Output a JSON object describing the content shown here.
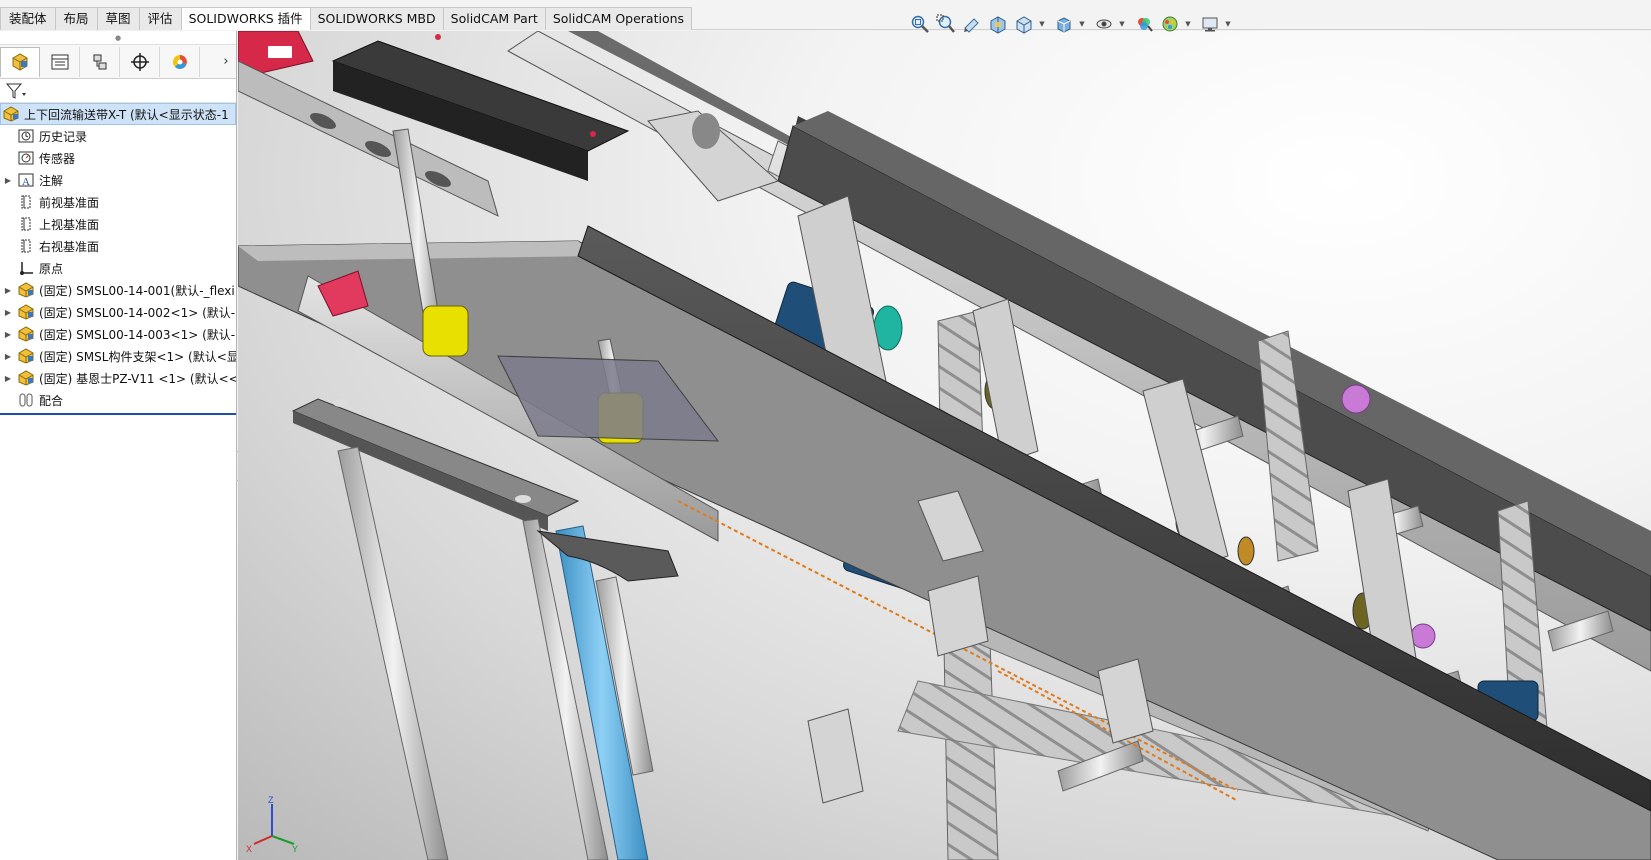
{
  "ribbon": {
    "tabs": [
      {
        "label": "装配体",
        "active": false
      },
      {
        "label": "布局",
        "active": false
      },
      {
        "label": "草图",
        "active": false
      },
      {
        "label": "评估",
        "active": false
      },
      {
        "label": "SOLIDWORKS 插件",
        "active": true
      },
      {
        "label": "SOLIDWORKS MBD",
        "active": false
      },
      {
        "label": "SolidCAM Part",
        "active": false
      },
      {
        "label": "SolidCAM Operations",
        "active": false
      }
    ]
  },
  "view_toolbar": {
    "icons": [
      "zoom-to-fit-icon",
      "zoom-to-area-icon",
      "previous-view-icon",
      "section-view-icon",
      "view-orientation-icon",
      "display-style-icon",
      "hide-show-items-icon",
      "edit-appearance-icon",
      "apply-scene-icon",
      "view-settings-icon"
    ]
  },
  "feature_tree": {
    "panel_tabs": [
      "feature-manager-icon",
      "property-manager-icon",
      "configuration-manager-icon",
      "dimxpert-manager-icon",
      "display-manager-icon"
    ],
    "root": "上下回流输送带X-T  (默认<显示状态-1",
    "items": [
      {
        "label": "历史记录",
        "icon": "history-icon",
        "expandable": false
      },
      {
        "label": "传感器",
        "icon": "sensor-icon",
        "expandable": false
      },
      {
        "label": "注解",
        "icon": "annotation-icon",
        "expandable": true
      },
      {
        "label": "前视基准面",
        "icon": "plane-icon",
        "expandable": false
      },
      {
        "label": "上视基准面",
        "icon": "plane-icon",
        "expandable": false
      },
      {
        "label": "右视基准面",
        "icon": "plane-icon",
        "expandable": false
      },
      {
        "label": "原点",
        "icon": "origin-icon",
        "expandable": false
      },
      {
        "label": "(固定) SMSL00-14-001(默认-_flexi",
        "icon": "assembly-icon",
        "expandable": true
      },
      {
        "label": "(固定) SMSL00-14-002<1> (默认-",
        "icon": "assembly-icon",
        "expandable": true
      },
      {
        "label": "(固定) SMSL00-14-003<1> (默认-",
        "icon": "assembly-icon",
        "expandable": true
      },
      {
        "label": "(固定) SMSL构件支架<1> (默认<显",
        "icon": "assembly-icon",
        "expandable": true
      },
      {
        "label": "(固定) 基恩士PZ-V11 <1> (默认<<",
        "icon": "assembly-icon",
        "expandable": true
      },
      {
        "label": "配合",
        "icon": "mates-icon",
        "expandable": false
      }
    ]
  },
  "triad": {
    "x": "X",
    "y": "Y",
    "z": "Z"
  },
  "colors": {
    "background_top": "#ffffff",
    "background_edge": "#b9b9b9",
    "frame_gray": "#bdbdbd",
    "dark_plate": "#3a3a3a",
    "yellow_bushing": "#e8e000",
    "blue_motor": "#1f4e78",
    "teal_wheel": "#1fb5a0",
    "red_block": "#d6294a",
    "cylinder_blue": "#5fb6e8",
    "belt_orange": "#e07b1b",
    "knob_pink": "#c97ad6"
  }
}
